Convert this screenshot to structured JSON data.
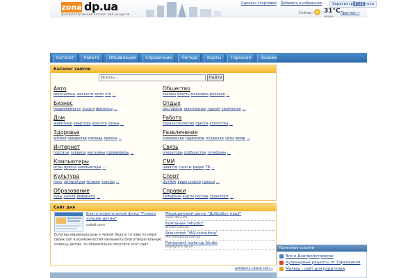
{
  "header": {
    "logo_box": "zona",
    "logo_text": "dp.ua",
    "tagline": "Днепропетровский каталог веб-ресурсов",
    "links": [
      "Сделать стартовой",
      "Добавить в избранное"
    ],
    "register": "Зарегистрироваться",
    "login": "Войти",
    "weather_label": "Сейчас:",
    "temperature": "31°C",
    "weather_sub": "жарко",
    "forecast": "Прогноз →"
  },
  "nav": {
    "tabs": [
      "Каталог",
      "Работа",
      "Объявления",
      "Справочник",
      "Погода",
      "Карты",
      "Гороскоп",
      "Знакомства"
    ]
  },
  "catalog": {
    "title": "Каталог сайтов",
    "search_placeholder": "Искать...",
    "search_button": "Найти",
    "left": [
      {
        "title": "Авто",
        "subs": [
          "автосалоны",
          "запчасти",
          "мото",
          "сто",
          "..."
        ]
      },
      {
        "title": "Бизнес",
        "subs": [
          "недвижимость",
          "услуги",
          "финансы",
          "..."
        ]
      },
      {
        "title": "Дом",
        "subs": [
          "животные",
          "квартира",
          "красота",
          "семья",
          "..."
        ]
      },
      {
        "title": "Здоровье",
        "subs": [
          "аптеки",
          "лекарства",
          "помощь",
          "прессы",
          "..."
        ]
      },
      {
        "title": "Интернет",
        "subs": [
          "порталы",
          "сервисы",
          "магазины",
          "провайдеры",
          "..."
        ]
      },
      {
        "title": "Компьютеры",
        "subs": [
          "игры",
          "пресса",
          "компьютеры",
          "..."
        ]
      },
      {
        "title": "Культура",
        "subs": [
          "кино",
          "литература",
          "музыка",
          "театры",
          "..."
        ]
      },
      {
        "title": "Образование",
        "subs": [
          "вузы",
          "школа",
          "рефераты",
          "..."
        ]
      }
    ],
    "right": [
      {
        "title": "Общество",
        "subs": [
          "законы",
          "власть",
          "политика",
          "религия",
          "..."
        ]
      },
      {
        "title": "Отдых",
        "subs": [
          "рестораны",
          "кинотеатры",
          "туризм",
          "увлечения",
          "..."
        ]
      },
      {
        "title": "Работа",
        "subs": [
          "трудоустройство",
          "пресса",
          "агентства",
          "..."
        ]
      },
      {
        "title": "Развлечения",
        "subs": [
          "знакомства",
          "гороскопы",
          "открытки",
          "чаты",
          "юмор",
          "..."
        ]
      },
      {
        "title": "Связь",
        "subs": [
          "операторы",
          "сообщества",
          "телефоны",
          "..."
        ]
      },
      {
        "title": "СМИ",
        "subs": [
          "новости",
          "газеты",
          "радио",
          "ТВ",
          "..."
        ]
      },
      {
        "title": "Спорт",
        "subs": [
          "футбол",
          "виды спорта",
          "пресса",
          "..."
        ]
      },
      {
        "title": "Справки",
        "subs": [
          "телефоны",
          "карты",
          "погода",
          "транспорт",
          "..."
        ]
      }
    ]
  },
  "site_of_day": {
    "title": "Сайт дня",
    "featured_title": "Благотворительный фонд \"Только лучшее детям\"",
    "featured_url": "uabdt.com",
    "description": "Если вы неравнодушны к чужой беде и готовы по мере своих сил и возможностей оказывать благотворительную помощь детям, то обязательно посетите этот сайт.",
    "list": [
      {
        "title": "Медицинский центр \"Добробут нації\"",
        "url": "clinic-dbn.info"
      },
      {
        "title": "Компания \"4hydro\"",
        "url": "4hydro.com.ua"
      },
      {
        "title": "Агентство \"MA-consulting\"",
        "url": "ma-consulting.com.ua"
      },
      {
        "title": "Permanent make-up Studio",
        "url": "beautyface.dp.ua"
      }
    ],
    "add_site": "добавить новый сайт »"
  },
  "useful": {
    "title": "Полезные ссылки",
    "items": [
      {
        "label": "Все о Днепропетровске",
        "color": "#4a7fc1"
      },
      {
        "label": "Кулинарные рецепты от Тарелкиной",
        "color": "#d2452c"
      },
      {
        "label": "Малыш - сайт для родителей",
        "color": "#e3a126"
      }
    ]
  },
  "colors": {
    "accent_orange": "#f28a1c",
    "nav_blue": "#2f6aaa",
    "panel_gold": "#f5b72e",
    "link_blue": "#1a3f8f"
  }
}
